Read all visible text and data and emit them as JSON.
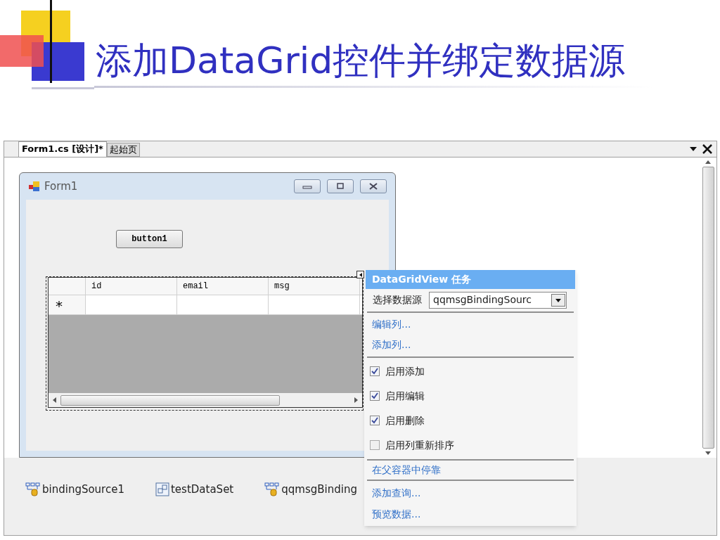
{
  "slide": {
    "title": "添加DataGrid控件并绑定数据源"
  },
  "tabs": [
    {
      "label": "Form1.cs [设计]*",
      "selected": true
    },
    {
      "label": "起始页",
      "selected": false
    }
  ],
  "form": {
    "title": "Form1",
    "button": "button1",
    "grid": {
      "columns": [
        "id",
        "email",
        "msg"
      ],
      "new_row_marker": "*"
    }
  },
  "tasks": {
    "title": "DataGridView 任务",
    "datasource_label": "选择数据源",
    "datasource_value": "qqmsgBindingSourc",
    "column_links": [
      "编辑列...",
      "添加列..."
    ],
    "options": [
      {
        "label": "启用添加",
        "checked": true
      },
      {
        "label": "启用编辑",
        "checked": true
      },
      {
        "label": "启用删除",
        "checked": true
      },
      {
        "label": "启用列重新排序",
        "checked": false
      }
    ],
    "dock_link": "在父容器中停靠",
    "data_links": [
      "添加查询...",
      "预览数据..."
    ]
  },
  "components": [
    {
      "name": "bindingSource1",
      "kind": "binding"
    },
    {
      "name": "testDataSet",
      "kind": "dataset"
    },
    {
      "name": "qqmsgBinding",
      "kind": "binding"
    }
  ]
}
